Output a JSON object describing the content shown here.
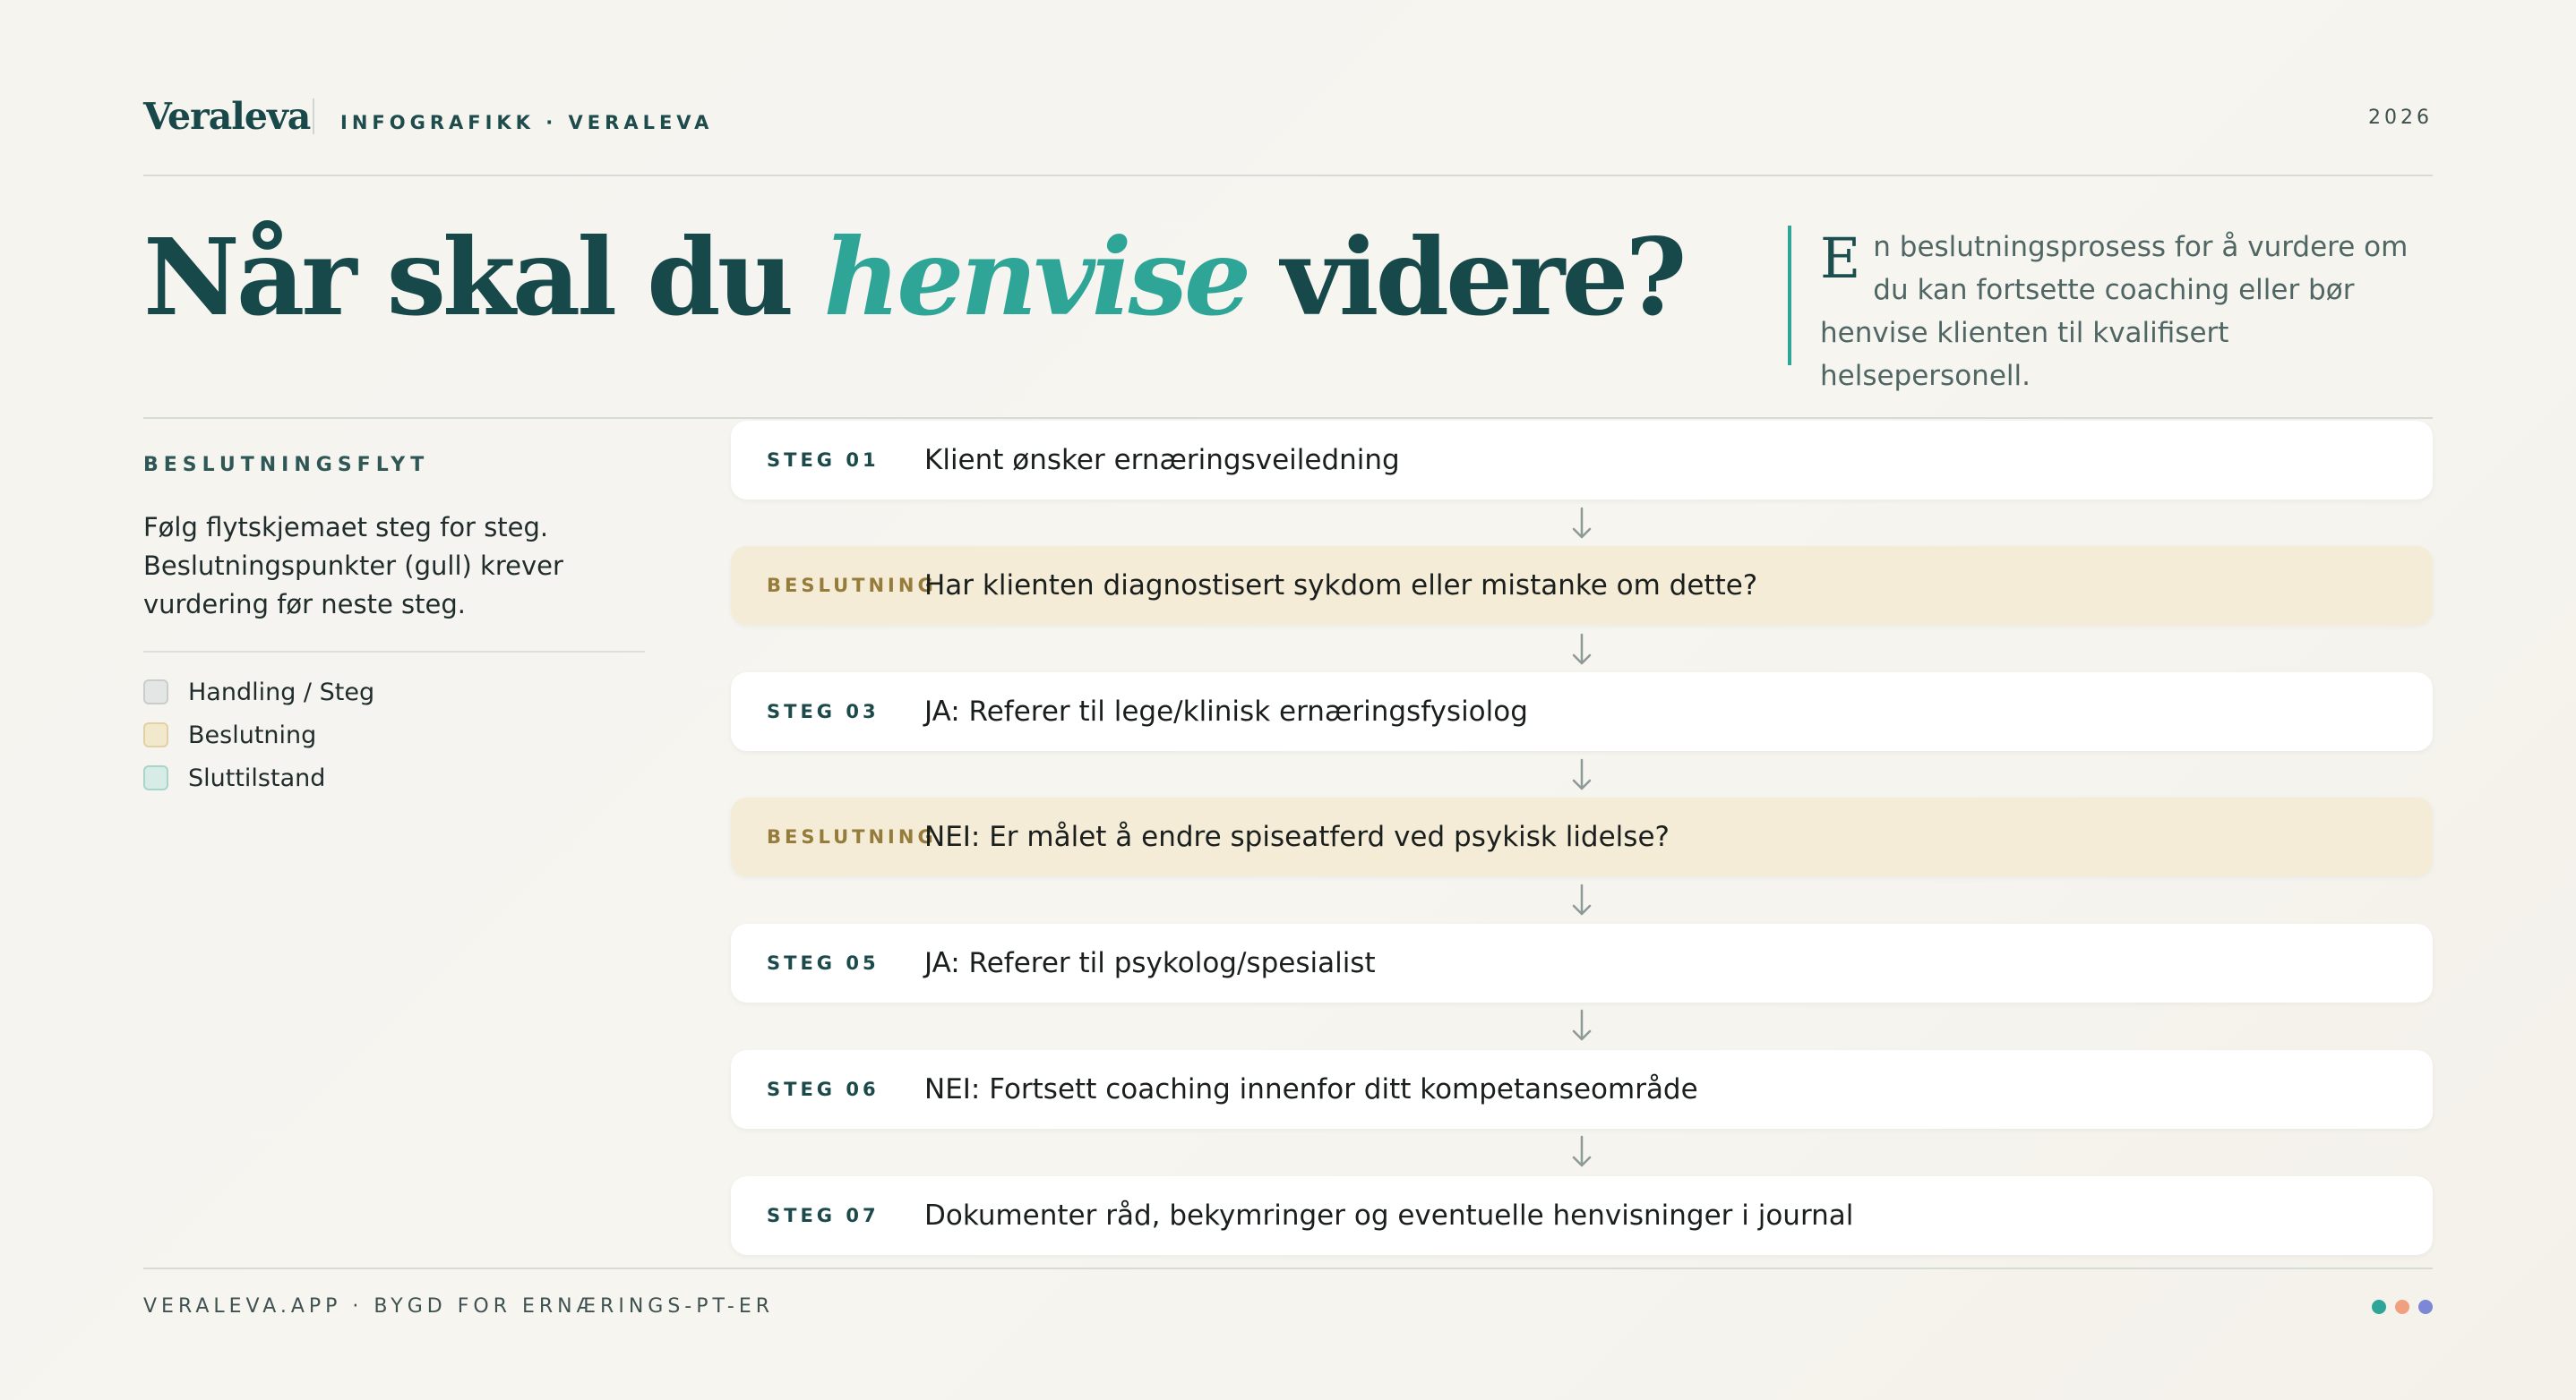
{
  "header": {
    "brand": "Veraleva",
    "tagline": "INFOGRAFIKK · VERALEVA",
    "year": "2026"
  },
  "title": {
    "before": "Når skal du ",
    "highlight": "henvise",
    "after": " videre?"
  },
  "lead": {
    "dropcap": "E",
    "text": "n beslutningsprosess for å vurdere om du kan fortsette coaching eller bør henvise klienten til kvalifisert helsepersonell."
  },
  "sidebar": {
    "label": "BESLUTNINGSFLYT",
    "description": "Følg flytskjemaet steg for steg. Beslutningspunkter (gull) krever vurdering før neste steg.",
    "legend": [
      {
        "label": "Handling / Steg"
      },
      {
        "label": "Beslutning"
      },
      {
        "label": "Sluttilstand"
      }
    ]
  },
  "flow": [
    {
      "tag": "STEG 01",
      "text": "Klient ønsker ernæringsveiledning",
      "kind": "step"
    },
    {
      "tag": "BESLUTNING",
      "text": "Har klienten diagnostisert sykdom eller mistanke om dette?",
      "kind": "decision"
    },
    {
      "tag": "STEG 03",
      "text": "JA: Referer til lege/klinisk ernæringsfysiolog",
      "kind": "step"
    },
    {
      "tag": "BESLUTNING",
      "text": "NEI: Er målet å endre spiseatferd ved psykisk lidelse?",
      "kind": "decision"
    },
    {
      "tag": "STEG 05",
      "text": "JA: Referer til psykolog/spesialist",
      "kind": "step"
    },
    {
      "tag": "STEG 06",
      "text": "NEI: Fortsett coaching innenfor ditt kompetanseområde",
      "kind": "step"
    },
    {
      "tag": "STEG 07",
      "text": "Dokumenter råd, bekymringer og eventuelle henvisninger i journal",
      "kind": "step"
    }
  ],
  "footer": {
    "text": "VERALEVA.APP · BYGD FOR ERNÆRINGS-PT-ER"
  },
  "colors": {
    "teal_dark": "#17484a",
    "accent": "#2ea596",
    "decision_bg": "#f4ecd6",
    "dot_teal": "#2ea596",
    "dot_coral": "#f0a07e",
    "dot_indigo": "#7c88d6"
  },
  "icons": {
    "flow_arrow": "arrow-down-icon"
  }
}
